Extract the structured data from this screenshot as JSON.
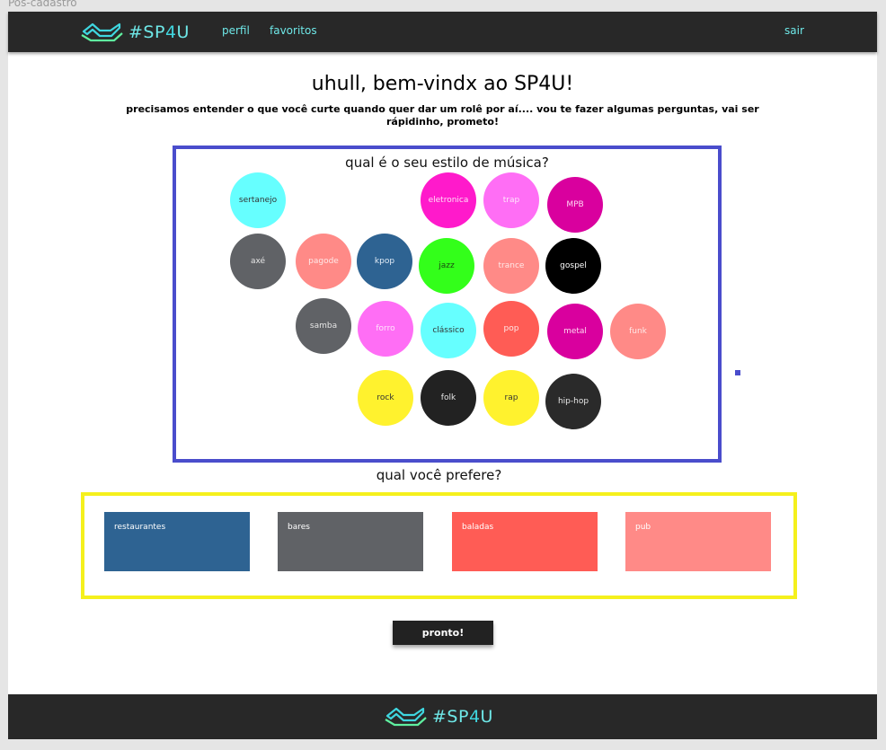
{
  "frame_label": "Pós-cadastro",
  "brand": {
    "hash": "#SP",
    "four": "4",
    "u": "U"
  },
  "nav": {
    "profile": "perfil",
    "favorites": "favoritos",
    "logout": "sair"
  },
  "welcome": {
    "title": "uhull, bem-vindx ao SP4U!",
    "subtitle": "precisamos entender o que você curte quando quer dar um rolê por aí.... vou te fazer algumas perguntas, vai ser rápidinho, prometo!"
  },
  "music": {
    "question": "qual é o seu estilo de música?",
    "genres": [
      {
        "label": "sertanejo",
        "color": "#66ffff",
        "text": "#333333"
      },
      {
        "label": "eletronica",
        "color": "#ff1acb",
        "text": "#ffdff7"
      },
      {
        "label": "trap",
        "color": "#ff6ef5",
        "text": "#ffe6fc"
      },
      {
        "label": "MPB",
        "color": "#d9009e",
        "text": "#ffd6f2"
      },
      {
        "label": "axé",
        "color": "#606266",
        "text": "#e6e6e6"
      },
      {
        "label": "pagode",
        "color": "#ff8a87",
        "text": "#ffe8e7"
      },
      {
        "label": "kpop",
        "color": "#2e6392",
        "text": "#e2ecf6"
      },
      {
        "label": "jazz",
        "color": "#33ff1a",
        "text": "#1a4a10"
      },
      {
        "label": "trance",
        "color": "#ff8a87",
        "text": "#ffe8e7"
      },
      {
        "label": "gospel",
        "color": "#000000",
        "text": "#ffffff"
      },
      {
        "label": "samba",
        "color": "#606266",
        "text": "#e6e6e6"
      },
      {
        "label": "forro",
        "color": "#ff6ef5",
        "text": "#ffe6fc"
      },
      {
        "label": "clássico",
        "color": "#66ffff",
        "text": "#333333"
      },
      {
        "label": "pop",
        "color": "#ff5c55",
        "text": "#ffe6e5"
      },
      {
        "label": "metal",
        "color": "#d9009e",
        "text": "#ffd6f2"
      },
      {
        "label": "funk",
        "color": "#ff8a87",
        "text": "#ffe8e7"
      },
      {
        "label": "rock",
        "color": "#fff22e",
        "text": "#333333"
      },
      {
        "label": "folk",
        "color": "#222222",
        "text": "#e6e6e6"
      },
      {
        "label": "rap",
        "color": "#fff22e",
        "text": "#333333"
      },
      {
        "label": "hip-hop",
        "color": "#2a2a2a",
        "text": "#e6e6e6"
      }
    ]
  },
  "places": {
    "question": "qual você prefere?",
    "options": [
      {
        "label": "restaurantes",
        "color": "#2e6392"
      },
      {
        "label": "bares",
        "color": "#606266"
      },
      {
        "label": "baladas",
        "color": "#ff5c55"
      },
      {
        "label": "pub",
        "color": "#ff8a87"
      }
    ]
  },
  "actions": {
    "done": "pronto!"
  },
  "colors": {
    "music_border": "#4a4dcc",
    "places_border": "#f5f01c",
    "bars": "#282828",
    "accent": "#6ee7e7"
  }
}
